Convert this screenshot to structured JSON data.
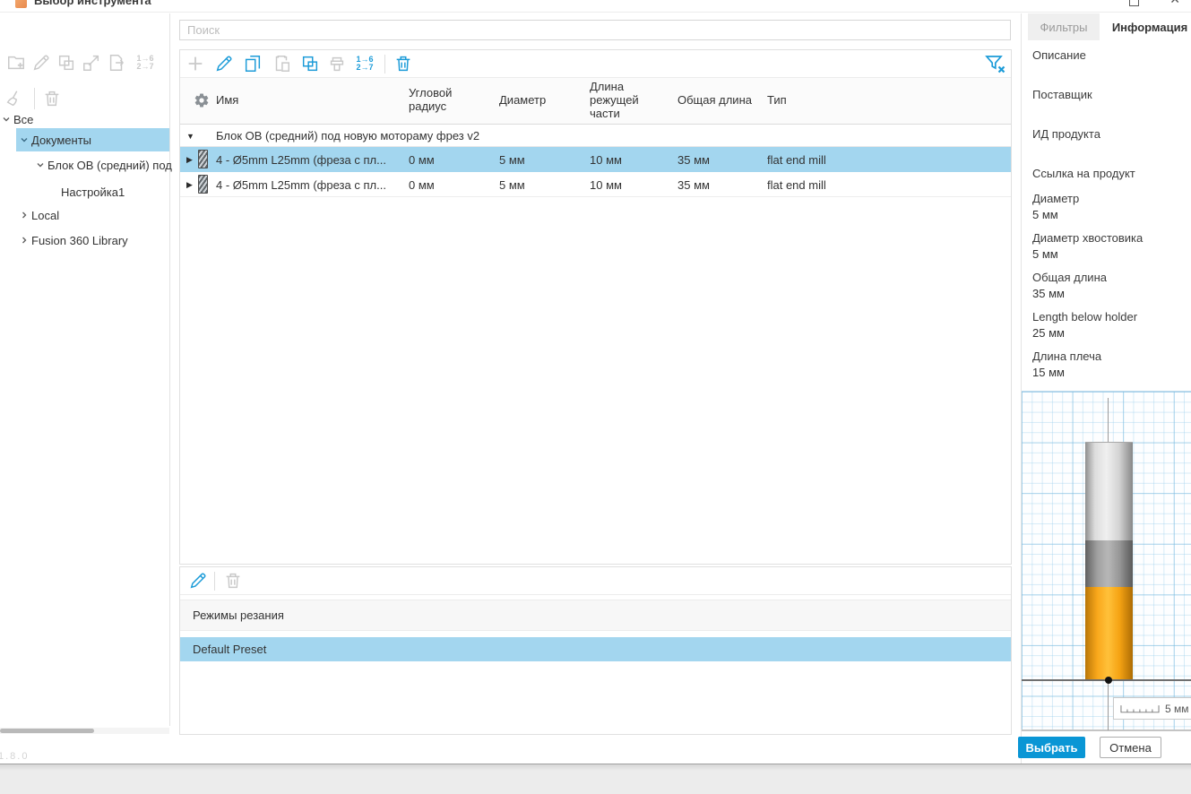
{
  "window": {
    "title": "Выбор инструмента",
    "version": "1.8.0"
  },
  "icons": {
    "expanded": "▼",
    "collapsed": "▶",
    "close": "✕"
  },
  "search": {
    "placeholder": "Поиск"
  },
  "renumber": {
    "line1": "1→6",
    "line2": "2→7"
  },
  "tree": {
    "root": "Все",
    "items": [
      {
        "label": "Документы",
        "state": "expanded",
        "selected": true
      },
      {
        "label": "Блок ОВ (средний) под",
        "state": "expanded",
        "selected": false
      },
      {
        "label": "Настройка1",
        "state": "none",
        "selected": false
      },
      {
        "label": "Local",
        "state": "collapsed",
        "selected": false
      },
      {
        "label": "Fusion 360 Library",
        "state": "collapsed",
        "selected": false
      }
    ]
  },
  "table": {
    "columns": [
      "Имя",
      "Угловой радиус",
      "Диаметр",
      "Длина режущей части",
      "Общая длина",
      "Тип"
    ],
    "group": "Блок ОВ (средний) под новую мотораму фрез v2",
    "rows": [
      {
        "name": "4 - Ø5mm L25mm (фреза с пл...",
        "corner_radius": "0 мм",
        "diameter": "5 мм",
        "flute_length": "10 мм",
        "overall_length": "35 мм",
        "type": "flat end mill",
        "selected": true
      },
      {
        "name": "4 - Ø5mm L25mm (фреза с пл...",
        "corner_radius": "0 мм",
        "diameter": "5 мм",
        "flute_length": "10 мм",
        "overall_length": "35 мм",
        "type": "flat end mill",
        "selected": false
      }
    ]
  },
  "presets": {
    "header": "Режимы резания",
    "items": [
      "Default Preset"
    ]
  },
  "right_panel": {
    "tabs": [
      {
        "label": "Фильтры",
        "active": false
      },
      {
        "label": "Информация",
        "active": true
      }
    ],
    "fields": [
      {
        "label": "Описание",
        "value": ""
      },
      {
        "label": "Поставщик",
        "value": ""
      },
      {
        "label": "ИД продукта",
        "value": ""
      },
      {
        "label": "Ссылка на продукт",
        "value": ""
      },
      {
        "label": "Диаметр",
        "value": "5 мм"
      },
      {
        "label": "Диаметр хвостовика",
        "value": "5 мм"
      },
      {
        "label": "Общая длина",
        "value": "35 мм"
      },
      {
        "label": "Length below holder",
        "value": "25 мм"
      },
      {
        "label": "Длина плеча",
        "value": "15 мм"
      }
    ],
    "preview": {
      "scale_label": "5 мм"
    }
  },
  "footer": {
    "select": "Выбрать",
    "cancel": "Отмена"
  },
  "colors": {
    "accent": "#0a96d5",
    "selection": "#a3d6ef",
    "flute": "#f5a623",
    "grid": "#cfe7f4"
  }
}
